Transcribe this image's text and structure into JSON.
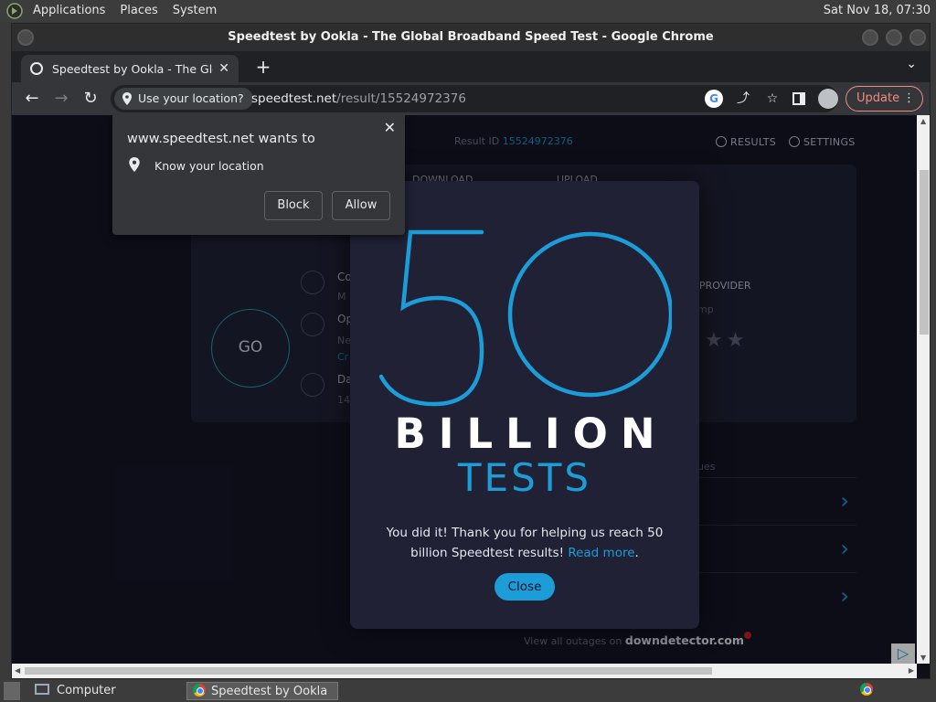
{
  "top_panel": {
    "menus": [
      "Applications",
      "Places",
      "System"
    ],
    "clock": "Sat Nov 18, 07:30"
  },
  "window": {
    "title": "Speedtest by Ookla - The Global Broadband Speed Test - Google Chrome"
  },
  "tab": {
    "title": "Speedtest by Ookla - The Global Broadband Speed Test",
    "close": "✕",
    "new_tab": "+",
    "tab_menu": "⌄"
  },
  "toolbar": {
    "back": "←",
    "forward": "→",
    "reload": "↻",
    "location_chip": "Use your location?",
    "url_domain": "speedtest.net",
    "url_path": "/result/15524972376",
    "share": "⤴",
    "star": "☆",
    "update_label": "Update",
    "menu_dots": "⋮"
  },
  "permission": {
    "title": "www.speedtest.net wants to",
    "item": "Know your location",
    "block_label": "Block",
    "allow_label": "Allow",
    "close": "✕"
  },
  "page": {
    "result_id_label": "Result ID",
    "result_id": "15524972376",
    "results_label": "RESULTS",
    "settings_label": "SETTINGS",
    "download_label": "DOWNLOAD",
    "upload_label": "UPLOAD",
    "go_label": "GO",
    "conn_label": "Co",
    "conn_sub": "M",
    "op_label": "Op",
    "op_sub": "Ne",
    "op_link": "Cr",
    "da_label": "Da",
    "da_sub": "14",
    "provider_label": "PROVIDER",
    "provider_sub": "mp",
    "stars": "★★",
    "issues_label": "ues",
    "chevron": "›",
    "outages_prefix": "View all outages on",
    "outages_site": "downdetector.com",
    "ad_badge": "▷"
  },
  "modal": {
    "big_number": "50",
    "billion": "BILLION",
    "tests": "TESTS",
    "message": "You did it! Thank you for helping us reach 50 billion Speedtest results!",
    "read_more": "Read more",
    "period": ".",
    "close_label": "Close"
  },
  "taskbar": {
    "computer_label": "Computer",
    "chrome_task_label": "Speedtest by Ookla ..."
  },
  "colors": {
    "accent": "#1c9dd8",
    "modal_bg": "#202135",
    "page_bg": "#141526",
    "update_red": "#f28b82"
  }
}
